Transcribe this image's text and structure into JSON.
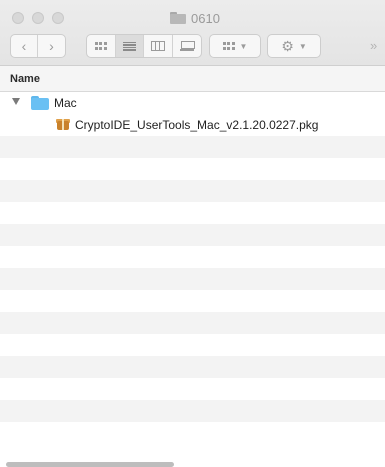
{
  "window": {
    "title": "0610",
    "toolbar": {
      "back_icon": "chevron-left-icon",
      "forward_icon": "chevron-right-icon",
      "view_modes": [
        "icon-view",
        "list-view",
        "column-view",
        "gallery-view"
      ],
      "selected_view": "list-view",
      "more_label": "»"
    }
  },
  "columns": {
    "name_header": "Name"
  },
  "files": [
    {
      "name": "Mac",
      "kind": "folder",
      "expanded": true,
      "depth": 0
    },
    {
      "name": "CryptoIDE_UserTools_Mac_v2.1.20.0227.pkg",
      "kind": "package",
      "depth": 1
    }
  ],
  "colors": {
    "folder": "#6ac0f3",
    "stripe": "#f3f3f3",
    "header": "#f5f5f5"
  }
}
